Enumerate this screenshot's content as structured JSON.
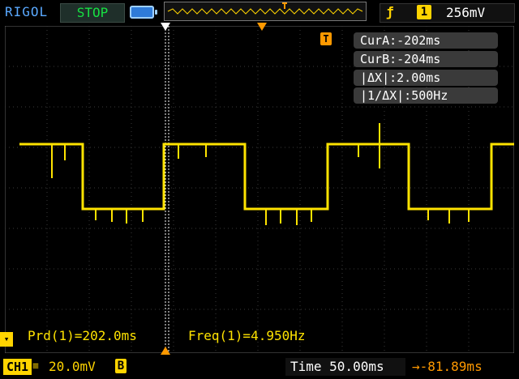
{
  "header": {
    "brand": "RIGOL",
    "run_state": "STOP",
    "trigger_source": "1",
    "trigger_level": "256mV"
  },
  "cursor_panel": {
    "cur_a": "CurA:-202ms",
    "cur_b": "CurB:-204ms",
    "delta_x": "|ΔX|:2.00ms",
    "inv_delta_x": "|1/ΔX|:500Hz"
  },
  "measurements": {
    "period": "Prd(1)=202.0ms",
    "frequency": "Freq(1)=4.950Hz"
  },
  "footer": {
    "channel": "CH1",
    "scale": "20.0mV",
    "bandwidth_limit": "B",
    "timebase": "Time 50.00ms",
    "trigger_delay": "→-81.89ms"
  },
  "colors": {
    "channel1": "#ffe300",
    "trigger": "#ff9900",
    "brand": "#5aa9ff",
    "run_state": "#17e043"
  },
  "icons": {
    "battery": "battery-icon",
    "trigger_edge": "rising-edge-icon",
    "trigger_marker": "trigger-t-icon"
  }
}
